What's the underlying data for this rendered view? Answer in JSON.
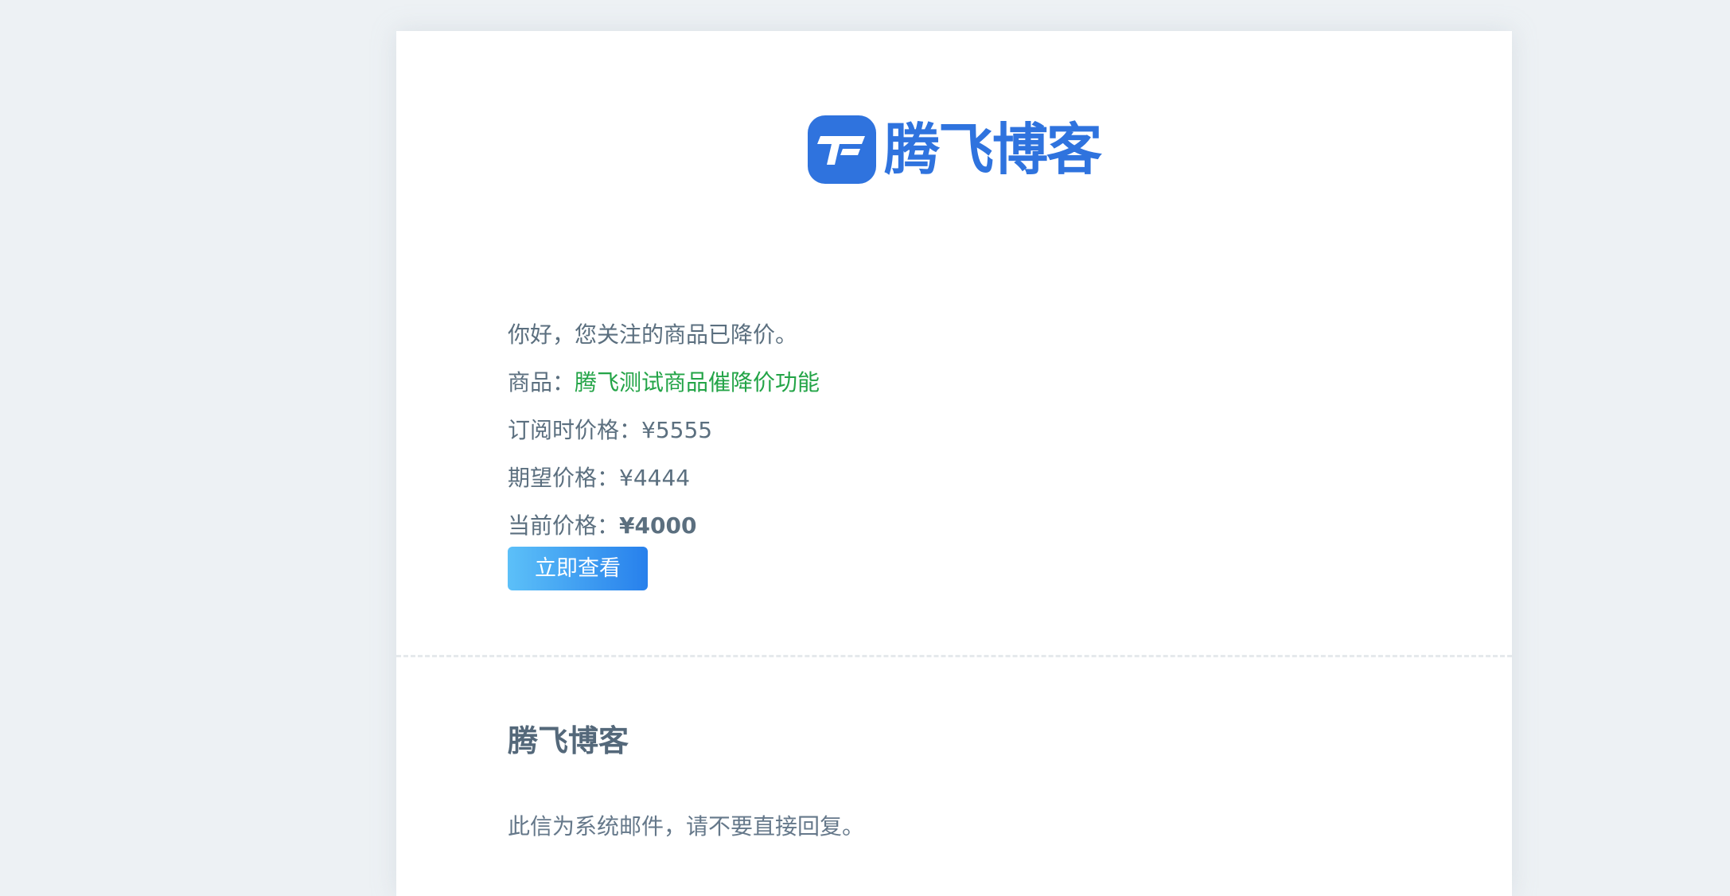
{
  "brand": {
    "name": "腾飞博客",
    "color": "#2f73de"
  },
  "message": {
    "greeting": "你好，您关注的商品已降价。",
    "product_label": "商品：",
    "product_name": "腾飞测试商品催降价功能",
    "subscribe_price_label": "订阅时价格：",
    "subscribe_price": "¥5555",
    "expected_price_label": "期望价格：",
    "expected_price": "¥4444",
    "current_price_label": "当前价格：",
    "current_price": "¥4000",
    "view_button": "立即查看"
  },
  "footer": {
    "title": "腾飞博客",
    "note": "此信为系统邮件，请不要直接回复。"
  },
  "colors": {
    "product_name": "#23a447",
    "button_start": "#5cc0f8",
    "button_end": "#2780ec",
    "text": "#5b6f7f"
  }
}
